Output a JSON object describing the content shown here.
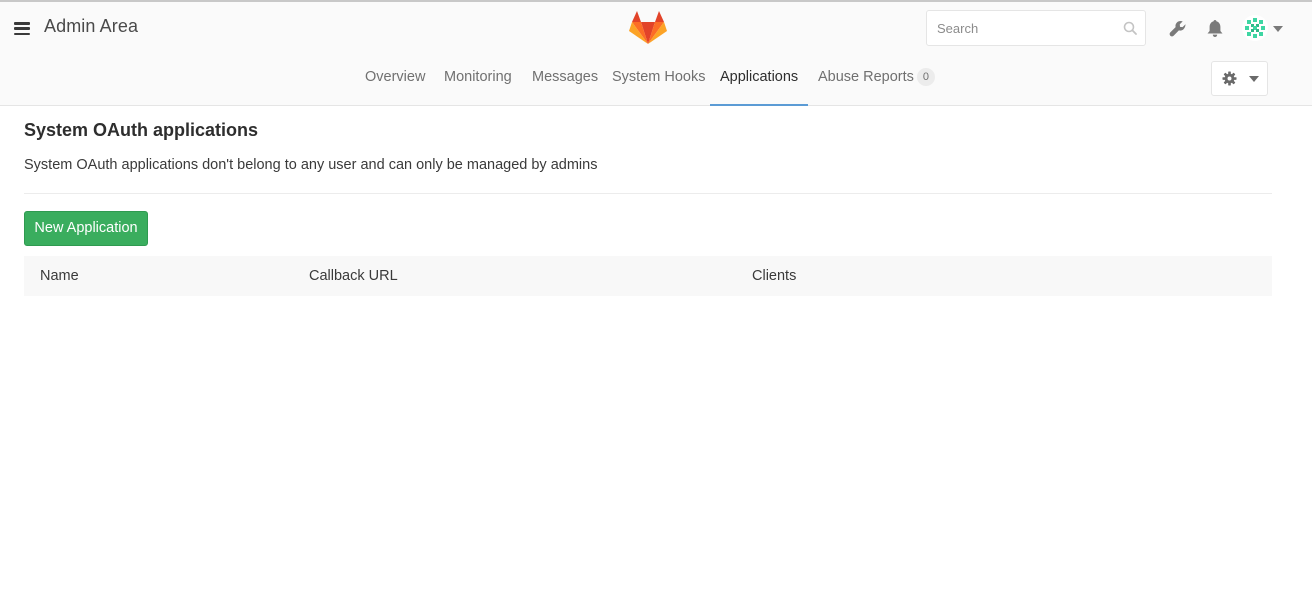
{
  "header": {
    "title": "Admin Area",
    "logo_icon": "gitlab-tanuki-icon",
    "search_placeholder": "Search",
    "icons": [
      "wrench-icon",
      "bell-icon",
      "avatar",
      "chevron-down-icon"
    ]
  },
  "nav": {
    "tabs": [
      {
        "label": "Overview"
      },
      {
        "label": "Monitoring"
      },
      {
        "label": "Messages"
      },
      {
        "label": "System Hooks"
      },
      {
        "label": "Applications",
        "active": true
      },
      {
        "label": "Abuse Reports",
        "badge": "0"
      }
    ],
    "settings_icon": "gear-icon"
  },
  "content": {
    "title": "System OAuth applications",
    "description": "System OAuth applications don't belong to any user and can only be managed by admins",
    "new_button": "New Application",
    "table": {
      "columns": [
        "Name",
        "Callback URL",
        "Clients"
      ],
      "rows": []
    }
  },
  "colors": {
    "accent_green": "#3aad5e",
    "active_tab_underline": "#5b9bd5",
    "header_bg": "#fafafa"
  }
}
